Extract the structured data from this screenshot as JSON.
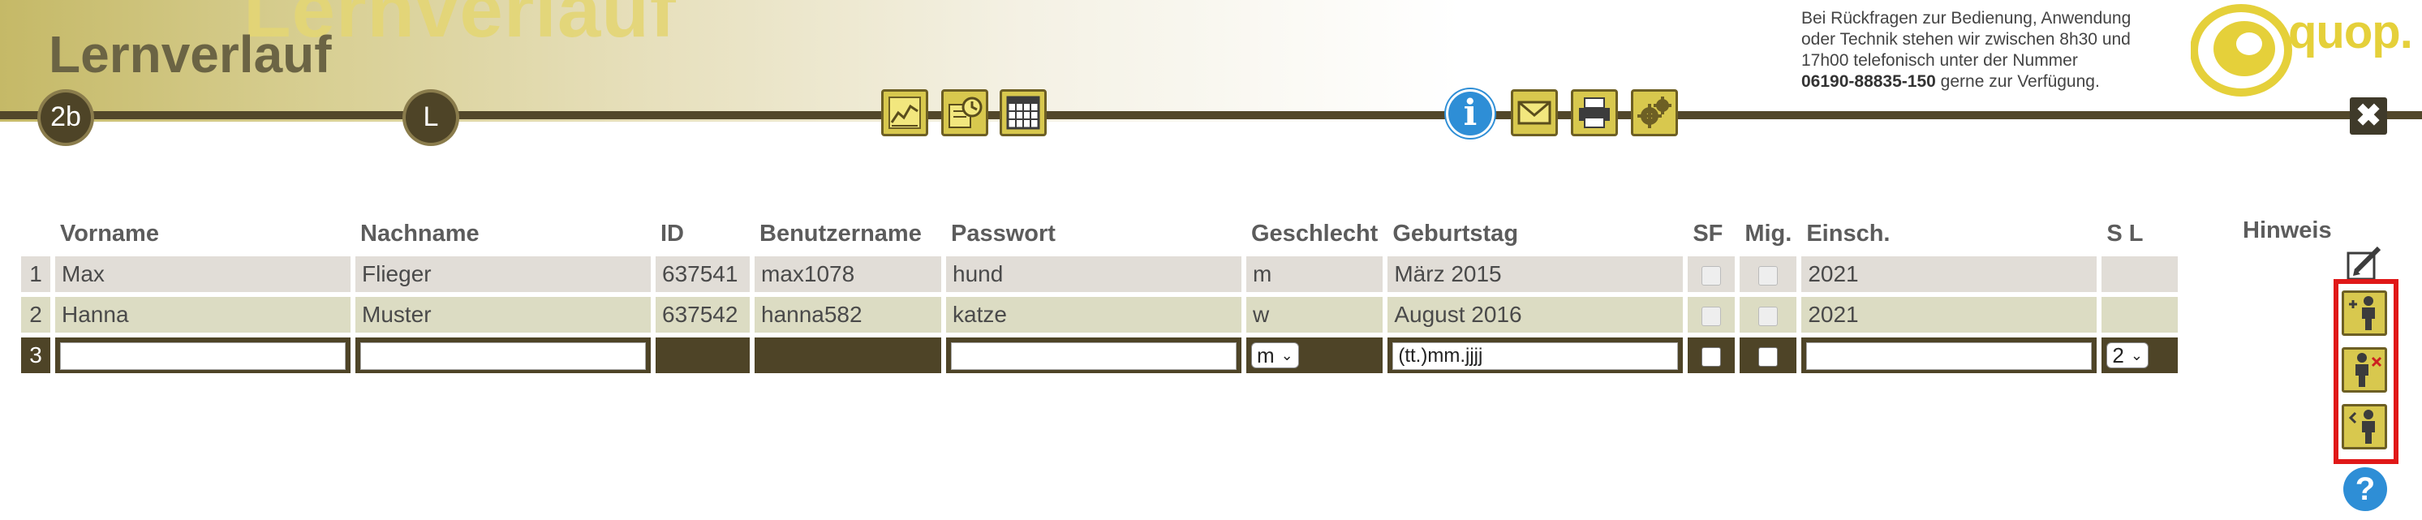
{
  "app": {
    "title": "Lernverlauf",
    "watermark": "Lernverlauf",
    "class_badge": "2b",
    "teacher_badge": "L"
  },
  "support": {
    "line1": "Bei Rückfragen zur Bedienung, Anwendung",
    "line2": "oder Technik stehen wir zwischen 8h30 und",
    "line3": "17h00 telefonisch unter der Nummer",
    "phone": "06190-88835-150",
    "line4_rest": " gerne zur Verfügung."
  },
  "logo": {
    "text": "quop."
  },
  "toolbar": {
    "icons": [
      "chart-icon",
      "schedule-icon",
      "calendar-grid-icon",
      "info-icon",
      "mail-icon",
      "print-icon",
      "settings-icon",
      "close-icon"
    ],
    "close_label": "✖"
  },
  "table": {
    "headers": [
      "Vorname",
      "Nachname",
      "ID",
      "Benutzername",
      "Passwort",
      "Geschlecht",
      "Geburtstag",
      "SF",
      "Mig.",
      "Einsch.",
      "S L",
      "Hinweis"
    ],
    "rows": [
      {
        "num": "1",
        "vorname": "Max",
        "nachname": "Flieger",
        "id": "637541",
        "benutzername": "max1078",
        "passwort": "hund",
        "geschlecht": "m",
        "geburtstag": "März 2015",
        "einsch": "2021"
      },
      {
        "num": "2",
        "vorname": "Hanna",
        "nachname": "Muster",
        "id": "637542",
        "benutzername": "hanna582",
        "passwort": "katze",
        "geschlecht": "w",
        "geburtstag": "August 2016",
        "einsch": "2021"
      }
    ],
    "new_row": {
      "num": "3",
      "gender_selected": "m",
      "birthday_value": "(tt.)mm.jjjj",
      "sl_selected": "2"
    }
  },
  "side_tools": {
    "icons": [
      "edit-icon",
      "add-student-icon",
      "remove-student-icon",
      "move-student-icon",
      "help-icon"
    ],
    "help_label": "?"
  },
  "colors": {
    "header_dark": "#52472a",
    "button_gold": "#d8c84e",
    "highlight_red": "#e01818",
    "info_blue": "#2e8ed6"
  }
}
